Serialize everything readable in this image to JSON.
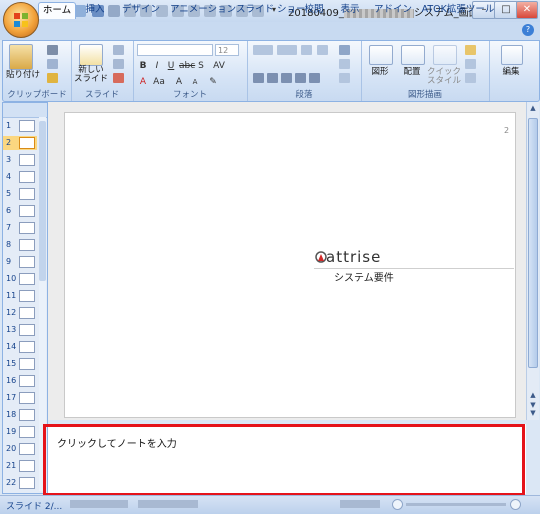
{
  "title": {
    "filename_prefix": "20180409_",
    "filename_suffix": "システム_画面設..."
  },
  "tabs": [
    {
      "label": "ホーム",
      "active": true
    },
    {
      "label": "挿入"
    },
    {
      "label": "デザイン"
    },
    {
      "label": "アニメーション"
    },
    {
      "label": "スライド ショー"
    },
    {
      "label": "校閲"
    },
    {
      "label": "表示"
    },
    {
      "label": "アドイン"
    },
    {
      "label": "ATOK拡張ツール"
    }
  ],
  "ribbon": {
    "groups": {
      "clipboard": "クリップボード",
      "slides": "スライド",
      "font": "フォント",
      "paragraph": "段落",
      "drawing": "図形描画"
    },
    "buttons": {
      "paste": "貼り付け",
      "new_slide_line1": "新しい",
      "new_slide_line2": "スライド",
      "shapes": "図形",
      "arrange": "配置",
      "quick_styles_line1": "クイック",
      "quick_styles_line2": "スタイル",
      "edit": "編集"
    },
    "font_size_value": "12"
  },
  "slides_panel": {
    "numbers": [
      "1",
      "2",
      "3",
      "4",
      "5",
      "6",
      "7",
      "8",
      "9",
      "10",
      "11",
      "12",
      "13",
      "14",
      "15",
      "16",
      "17",
      "18",
      "19",
      "20",
      "21",
      "22"
    ],
    "selected": "2"
  },
  "slide": {
    "page_number": "2",
    "brand": "attrise",
    "subtitle": "システム要件"
  },
  "notes": {
    "placeholder": "クリックしてノートを入力"
  },
  "status": {
    "slide_indicator": "スライド 2/..."
  },
  "colors": {
    "accent": "#15428b",
    "highlight_box": "#e5131a",
    "selected_thumb": "#fbd780",
    "brand_mark": "#d12a2a"
  }
}
